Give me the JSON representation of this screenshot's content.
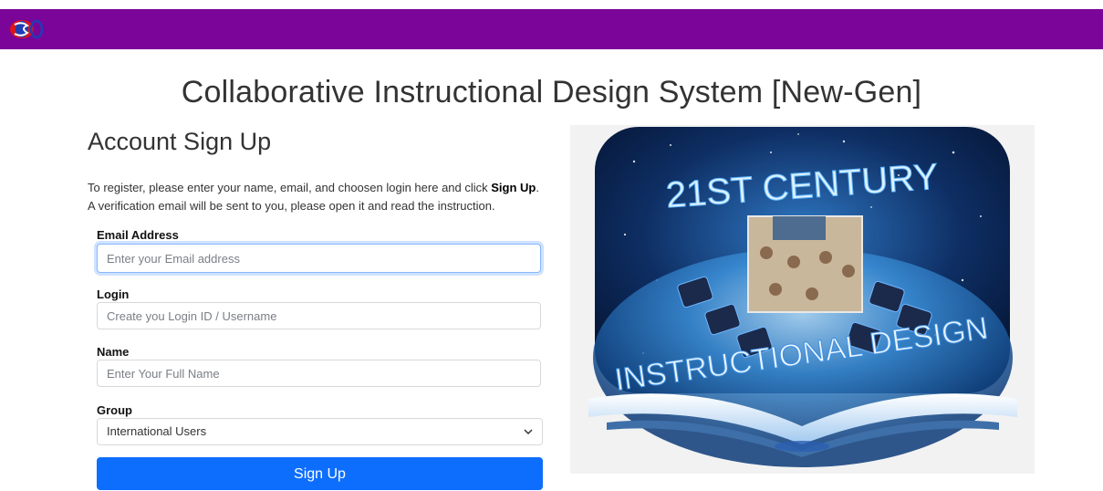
{
  "header": {
    "logo_icon": "sd-logo-icon",
    "bar_color": "#7a0598"
  },
  "page": {
    "title": "Collaborative Instructional Design System [New-Gen]"
  },
  "form": {
    "heading": "Account Sign Up",
    "intro_pre": "To register, please enter your name, email, and choosen login here and click ",
    "intro_bold": "Sign Up",
    "intro_post": ".",
    "intro_line2": "A verification email will be sent to you, please open it and read the instruction.",
    "email": {
      "label": "Email Address",
      "placeholder": "Enter your Email address",
      "value": ""
    },
    "login": {
      "label": "Login",
      "placeholder": "Create you Login ID / Username",
      "value": ""
    },
    "name": {
      "label": "Name",
      "placeholder": "Enter Your Full Name",
      "value": ""
    },
    "group": {
      "label": "Group",
      "selected": "International Users"
    },
    "submit_label": "Sign Up",
    "accent_color": "#0d6efd"
  },
  "hero": {
    "image_name": "21st-century-instructional-design-image",
    "text_top": "21ST CENTURY",
    "text_bottom": "INSTRUCTIONAL DESIGN"
  }
}
